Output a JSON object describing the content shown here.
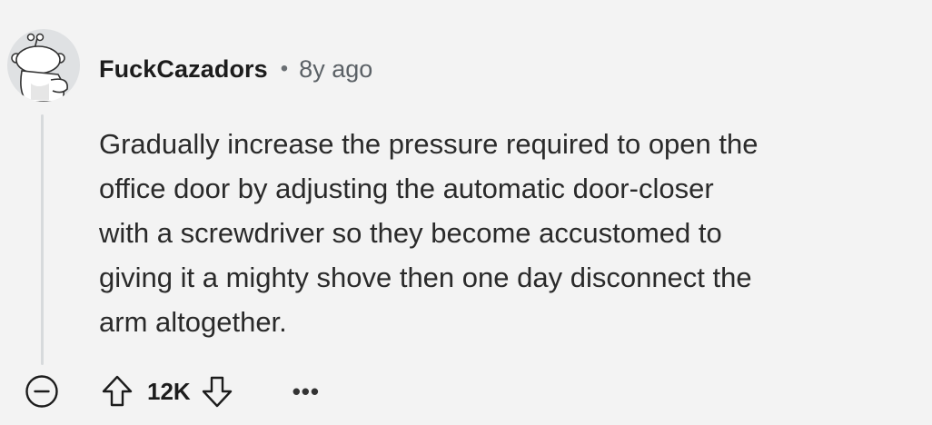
{
  "comment": {
    "author": "FuckCazadors",
    "separator": "•",
    "age": "8y ago",
    "body_lines": [
      "Gradually increase the pressure required to open the",
      "office door by adjusting the automatic door-closer",
      "with a screwdriver so they become accustomed to",
      "giving it a mighty shove then one day disconnect the",
      "arm altogether."
    ],
    "score": "12K",
    "more_label": "•••"
  },
  "icons": {
    "avatar": "default-snoo-avatar",
    "collapse": "minus-circle-icon",
    "upvote": "arrow-up-icon",
    "downvote": "arrow-down-icon",
    "more": "ellipsis-icon"
  },
  "colors": {
    "background": "#f3f3f3",
    "text": "#1c1c1c",
    "muted": "#5b6166",
    "thread_line": "#d7dadc"
  }
}
